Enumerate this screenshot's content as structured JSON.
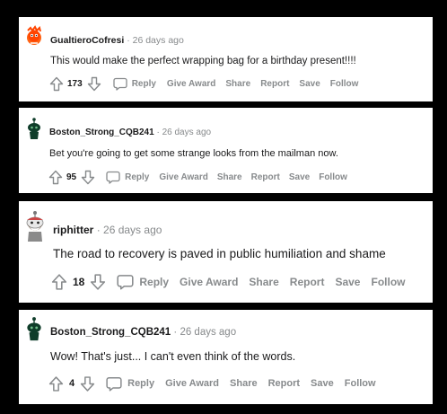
{
  "comments": [
    {
      "username": "GualtieroCofresi",
      "sep": "·",
      "age": "26 days ago",
      "text": "This would make the perfect wrapping bag for a birthday present!!!!",
      "votes": "173",
      "actions": [
        "Reply",
        "Give Award",
        "Share",
        "Report",
        "Save",
        "Follow"
      ],
      "avatar": "orange-snoo-avatar"
    },
    {
      "username": "Boston_Strong_CQB241",
      "sep": "·",
      "age": "26 days ago",
      "text": "Bet you're going to get some strange looks from the mailman now.",
      "votes": "95",
      "actions": [
        "Reply",
        "Give Award",
        "Share",
        "Report",
        "Save",
        "Follow"
      ],
      "avatar": "green-snoo-avatar"
    },
    {
      "username": "riphitter",
      "sep": "·",
      "age": "26 days ago",
      "text": "The road to recovery is paved in public humiliation and shame",
      "votes": "18",
      "actions": [
        "Reply",
        "Give Award",
        "Share",
        "Report",
        "Save",
        "Follow"
      ],
      "avatar": "bearded-snoo-avatar"
    },
    {
      "username": "Boston_Strong_CQB241",
      "sep": "·",
      "age": "26 days ago",
      "text": "Wow! That's just... I can't even think of the words.",
      "votes": "4",
      "actions": [
        "Reply",
        "Give Award",
        "Share",
        "Report",
        "Save",
        "Follow"
      ],
      "avatar": "green-snoo-avatar"
    }
  ],
  "colors": {
    "background": "#000000",
    "card": "#ffffff",
    "text": "#1a1a1b",
    "muted": "#878a8c",
    "snoo_green": "#0f3d2a",
    "snoo_orange": "#ff4500"
  }
}
